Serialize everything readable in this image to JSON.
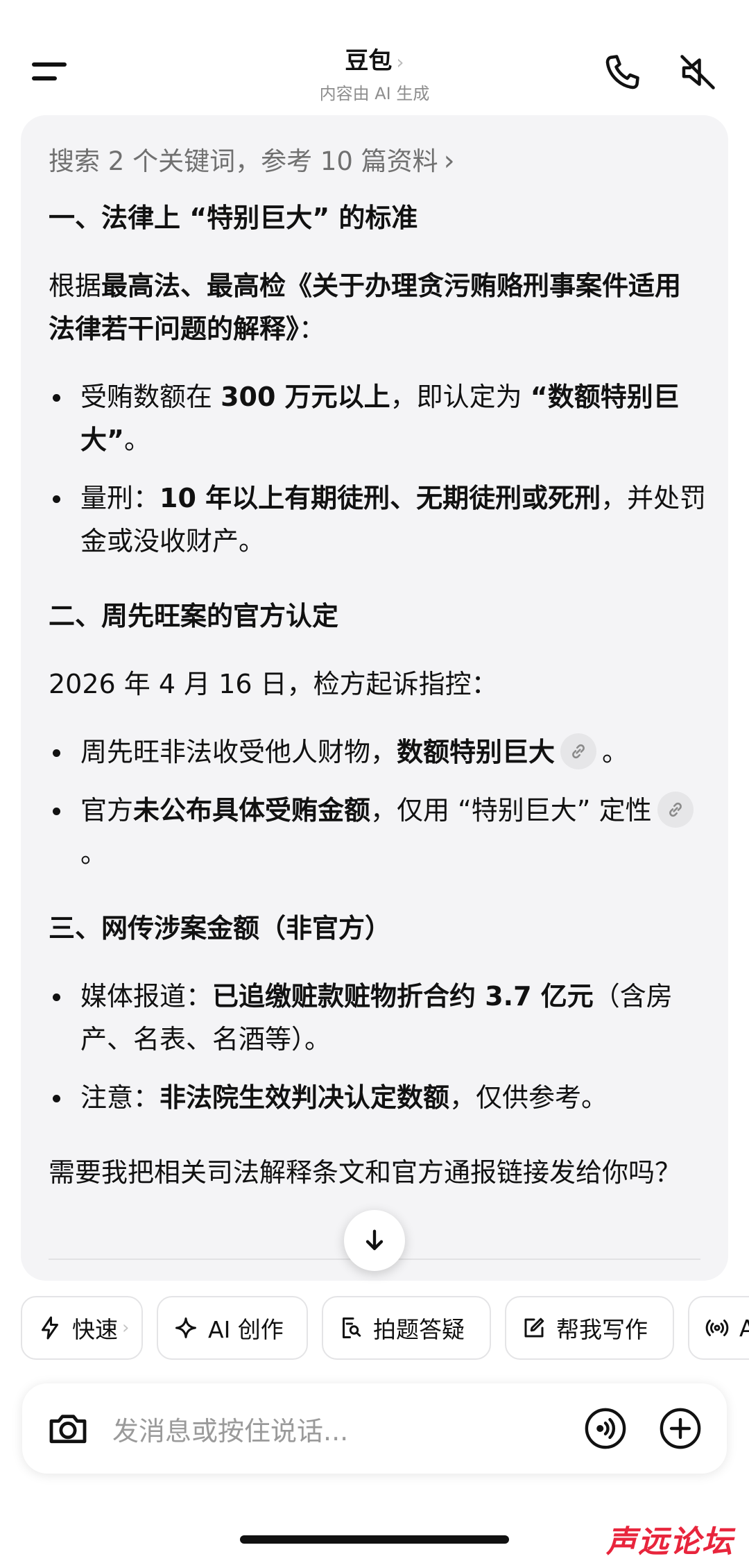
{
  "header": {
    "title": "豆包",
    "title_chevron": "›",
    "subtitle": "内容由 AI 生成",
    "icons": [
      "menu-icon",
      "phone-icon",
      "speaker-muted-icon"
    ]
  },
  "answer": {
    "search_summary": "搜索 2 个关键词，参考 10 篇资料",
    "search_arrow": "›",
    "section1": {
      "heading": "一、法律上 “特别巨大” 的标准",
      "intro_a": "根据",
      "intro_b": "最高法、最高检《关于办理贪污贿赂刑事案件适用法律若干问题的解释》",
      "intro_c": "：",
      "bullet1_a": "受贿数额在 ",
      "bullet1_b": "300 万元以上",
      "bullet1_c": "，即认定为 ",
      "bullet1_d": "“数额特别巨大”",
      "bullet1_e": "。",
      "bullet2_a": "量刑：",
      "bullet2_b": "10 年以上有期徒刑、无期徒刑或死刑",
      "bullet2_c": "，并处罚金或没收财产。"
    },
    "section2": {
      "heading": "二、周先旺案的官方认定",
      "intro": "2026 年 4 月 16 日，检方起诉指控：",
      "bullet1_a": "周先旺非法收受他人财物，",
      "bullet1_b": "数额特别巨大",
      "bullet1_c": "。",
      "bullet2_a": "官方",
      "bullet2_b": "未公布具体受贿金额",
      "bullet2_c": "，仅用 “特别巨大” 定性",
      "bullet2_d": "。"
    },
    "section3": {
      "heading": "三、网传涉案金额（非官方）",
      "bullet1_a": "媒体报道：",
      "bullet1_b": "已追缴赃款赃物折合约 3.7 亿元",
      "bullet1_c": "（含房产、名表、名酒等）。",
      "bullet2_a": "注意：",
      "bullet2_b": "非法院生效判决认定数额",
      "bullet2_c": "，仅供参考。"
    },
    "closing": "需要我把相关司法解释条文和官方通报链接发给你吗？"
  },
  "chips": [
    {
      "label": "快速",
      "icon": "lightning-icon",
      "chevron": "›"
    },
    {
      "label": "AI 创作",
      "icon": "sparkle-icon"
    },
    {
      "label": "拍题答疑",
      "icon": "photo-question-icon"
    },
    {
      "label": "帮我写作",
      "icon": "edit-icon"
    },
    {
      "label": "A",
      "icon": "broadcast-icon"
    }
  ],
  "input": {
    "placeholder": "发消息或按住说话..."
  },
  "watermark": "声远论坛"
}
